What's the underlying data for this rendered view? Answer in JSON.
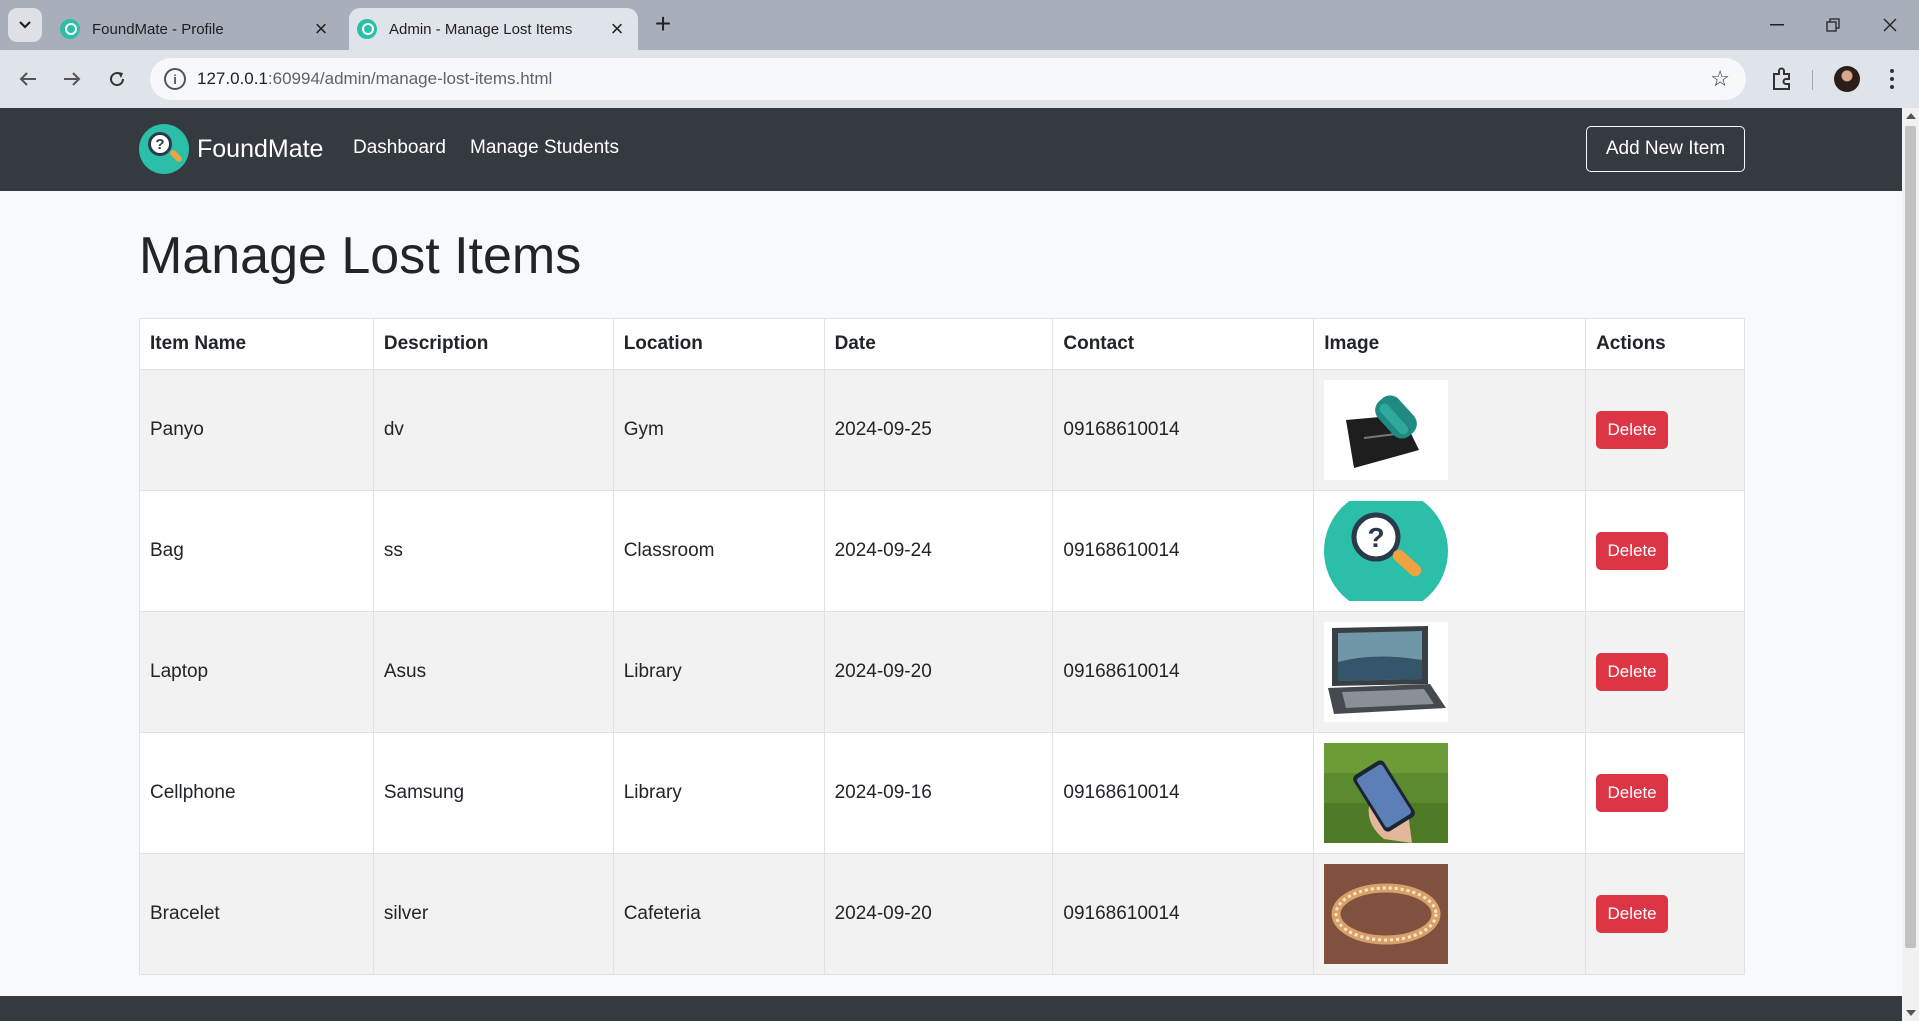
{
  "browser": {
    "tabs": [
      {
        "title": "FoundMate - Profile",
        "active": false
      },
      {
        "title": "Admin - Manage Lost Items",
        "active": true
      }
    ],
    "url_host": "127.0.0.1",
    "url_rest": ":60994/admin/manage-lost-items.html"
  },
  "navbar": {
    "brand": "FoundMate",
    "links": [
      "Dashboard",
      "Manage Students"
    ],
    "add_button": "Add New Item"
  },
  "page": {
    "title": "Manage Lost Items"
  },
  "table": {
    "headers": [
      "Item Name",
      "Description",
      "Location",
      "Date",
      "Contact",
      "Image",
      "Actions"
    ],
    "rows": [
      {
        "name": "Panyo",
        "description": "dv",
        "location": "Gym",
        "date": "2024-09-25",
        "contact": "09168610014",
        "image": "towel-and-pouch-photo",
        "action": "Delete"
      },
      {
        "name": "Bag",
        "description": "ss",
        "location": "Classroom",
        "date": "2024-09-24",
        "contact": "09168610014",
        "image": "foundmate-logo-placeholder",
        "action": "Delete"
      },
      {
        "name": "Laptop",
        "description": "Asus",
        "location": "Library",
        "date": "2024-09-20",
        "contact": "09168610014",
        "image": "laptop-photo",
        "action": "Delete"
      },
      {
        "name": "Cellphone",
        "description": "Samsung",
        "location": "Library",
        "date": "2024-09-16",
        "contact": "09168610014",
        "image": "smartphone-in-hand-photo",
        "action": "Delete"
      },
      {
        "name": "Bracelet",
        "description": "silver",
        "location": "Cafeteria",
        "date": "2024-09-20",
        "contact": "09168610014",
        "image": "bracelet-photo",
        "action": "Delete"
      }
    ]
  },
  "colors": {
    "navbar": "#343a40",
    "brand_teal": "#2bbfa9",
    "delete_red": "#dc3545",
    "row_stripe": "#f2f2f2"
  }
}
